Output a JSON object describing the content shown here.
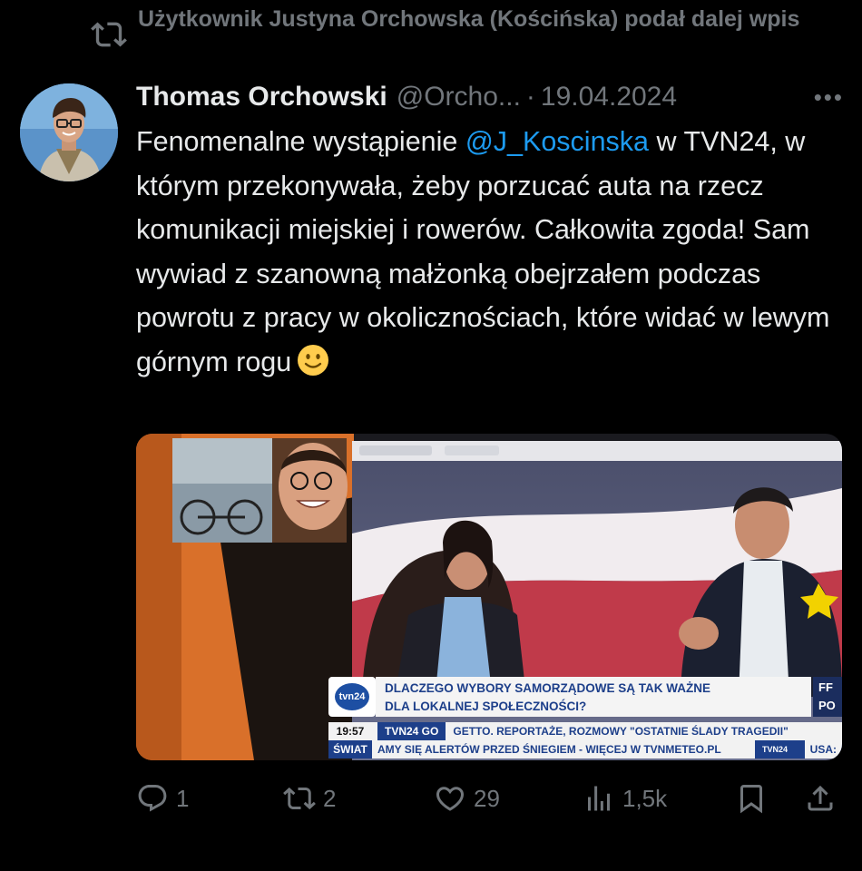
{
  "repost": {
    "text": "Użytkownik Justyna Orchowska (Kościńska) podał dalej wpis"
  },
  "tweet": {
    "author": "Thomas Orchowski",
    "handle": "@Orcho...",
    "separator": "·",
    "date": "19.04.2024",
    "more": "•••",
    "text_before": "Fenomenalne wystąpienie ",
    "mention": "@J_Koscinska",
    "text_after": " w TVN24, w którym przekonywała, żeby porzucać auta na rzecz komunikacji miejskiej i rowerów. Całkowita zgoda! Sam wywiad z szanowną małżonką obejrzałem podczas powrotu z pracy w okolicznościach, które widać w lewym górnym rogu",
    "emoji_icon": "slightly-smiling-face"
  },
  "media": {
    "tv_logo": "tvn24",
    "headline_line1": "DLACZEGO WYBORY SAMORZĄDOWE SĄ TAK WAŻNE",
    "headline_line2": "DLA LOKALNEJ SPOŁECZNOŚCI?",
    "side_label_top": "FF",
    "side_label_bottom": "PO",
    "time": "19:57",
    "channel_tag": "TVN24 GO",
    "ticker1": "GETTO. REPORTAŻE, ROZMOWY \"OSTATNIE ŚLADY TRAGEDII\"",
    "section": "ŚWIAT",
    "ticker2": "AMY SIĘ ALERTÓW PRZED ŚNIEGIEM - WIĘCEJ W TVNMETEO.PL",
    "small_logo": "TVN24",
    "ticker2_right": "USA:"
  },
  "actions": {
    "reply_count": "1",
    "repost_count": "2",
    "like_count": "29",
    "views_count": "1,5k"
  },
  "colors": {
    "background": "#000000",
    "text": "#e7e9ea",
    "secondary": "#71767b",
    "accent": "#1d9bf0"
  }
}
